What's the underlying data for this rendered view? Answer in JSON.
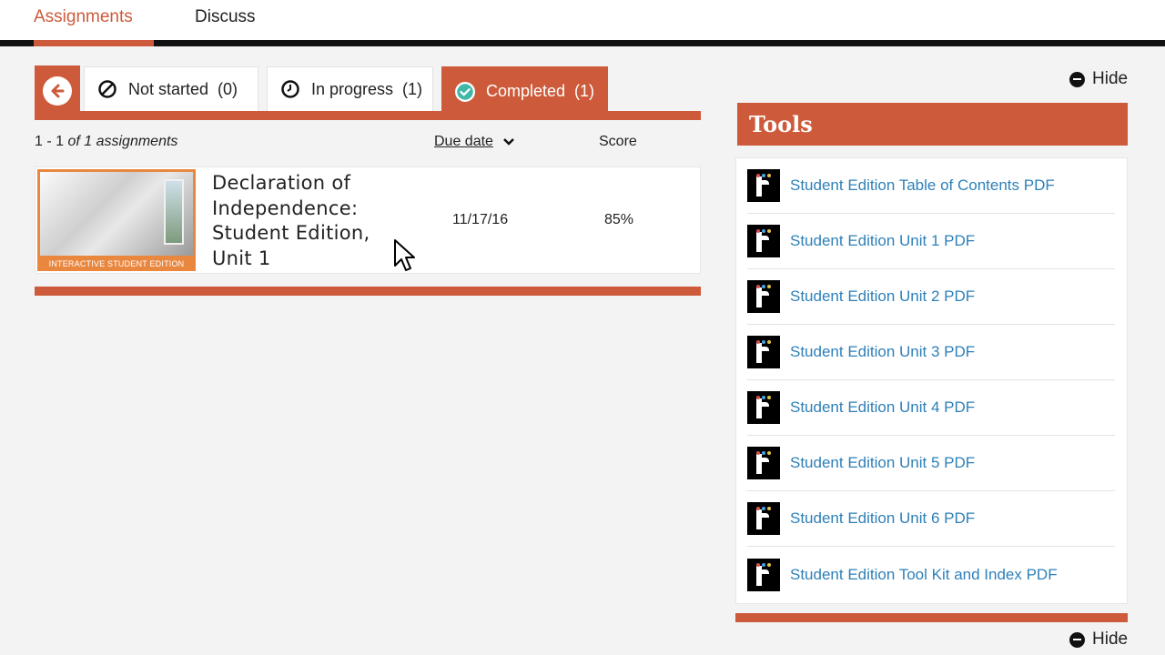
{
  "nav": {
    "tabs": [
      {
        "label": "Assignments",
        "active": true
      },
      {
        "label": "Discuss",
        "active": false
      }
    ]
  },
  "filters": {
    "back_icon": "arrow-left-icon",
    "tabs": [
      {
        "label": "Not started",
        "count": "(0)",
        "icon": "ban-icon",
        "active": false
      },
      {
        "label": "In progress",
        "count": "(1)",
        "icon": "clock-icon",
        "active": false
      },
      {
        "label": "Completed",
        "count": "(1)",
        "icon": "check-circle-icon",
        "active": true
      }
    ]
  },
  "list": {
    "range": "1 - 1",
    "of_text": "of 1 assignments",
    "due_header": "Due date",
    "score_header": "Score",
    "rows": [
      {
        "thumb_label": "INTERACTIVE STUDENT EDITION",
        "title": "Declaration of Independence: Student Edition, Unit 1",
        "due": "11/17/16",
        "score": "85%"
      }
    ]
  },
  "hide_label": "Hide",
  "tools": {
    "title": "Tools",
    "items": [
      "Student Edition Table of Contents PDF",
      "Student Edition Unit 1 PDF",
      "Student Edition Unit 2 PDF",
      "Student Edition Unit 3 PDF",
      "Student Edition Unit 4 PDF",
      "Student Edition Unit 5 PDF",
      "Student Edition Unit 6 PDF",
      "Student Edition Tool Kit and Index PDF"
    ]
  },
  "colors": {
    "accent": "#cd5b3b",
    "link": "#2e80b8",
    "thumb_border": "#e9873f"
  }
}
